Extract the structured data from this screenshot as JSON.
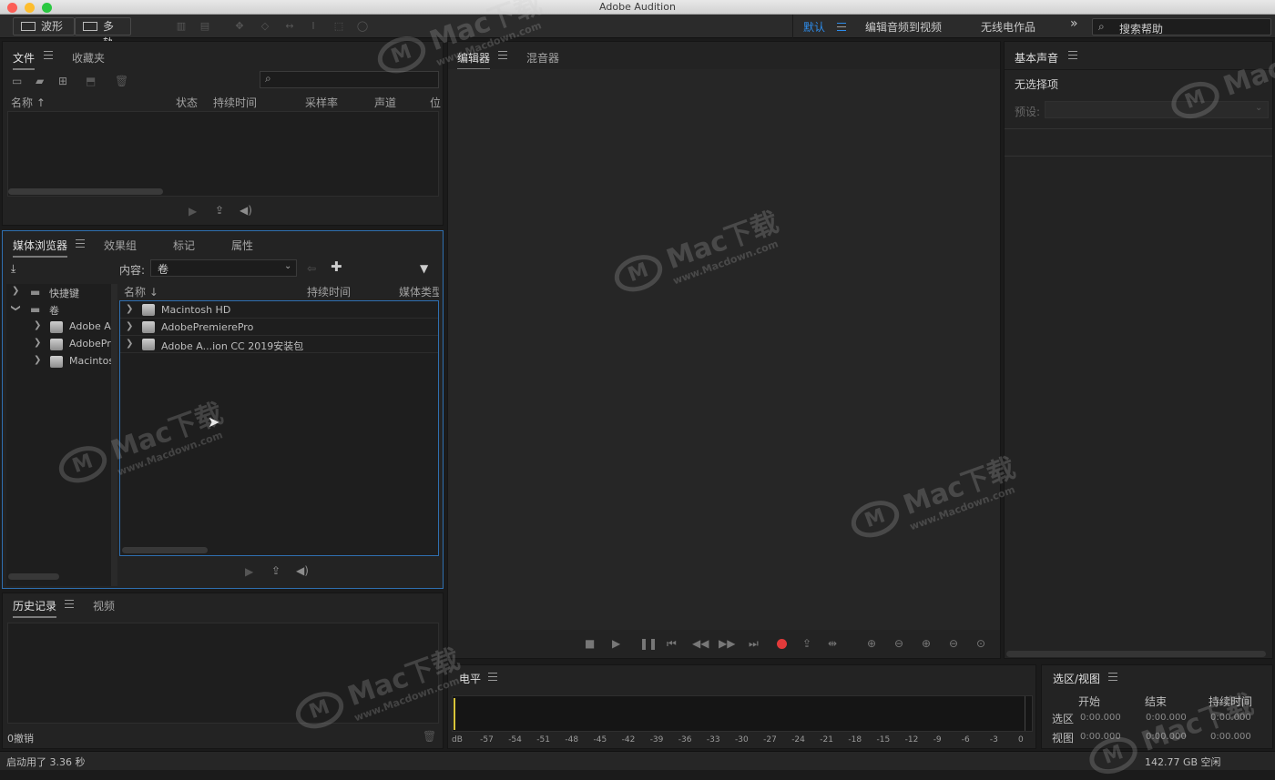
{
  "app": {
    "title": "Adobe Audition"
  },
  "toolbar": {
    "waveform": "波形",
    "multitrack": "多轨",
    "workspaces": [
      "默认",
      "编辑音频到视频",
      "无线电作品"
    ],
    "search_placeholder": "搜索帮助"
  },
  "files_panel": {
    "tabs": [
      "文件",
      "收藏夹"
    ],
    "columns": [
      "名称 ↑",
      "状态",
      "持续时间",
      "采样率",
      "声道",
      "位"
    ]
  },
  "media_panel": {
    "tabs": [
      "媒体浏览器",
      "效果组",
      "标记",
      "属性"
    ],
    "content_label": "内容:",
    "content_value": "卷",
    "tree": {
      "shortcuts": "快捷键",
      "volumes": "卷",
      "items": [
        "Adobe Au",
        "AdobePre",
        "Macintos"
      ]
    },
    "columns": [
      "名称 ↓",
      "持续时间",
      "媒体类型"
    ],
    "rows": [
      "Macintosh HD",
      "AdobePremierePro",
      "Adobe A...ion CC 2019安装包"
    ]
  },
  "history_panel": {
    "tabs": [
      "历史记录",
      "视频"
    ],
    "undo": "0撤销"
  },
  "status": {
    "startup": "启动用了 3.36 秒",
    "disk_free": "142.77 GB 空闲"
  },
  "editor_panel": {
    "tabs": [
      "编辑器",
      "混音器"
    ]
  },
  "essential_sound": {
    "title": "基本声音",
    "no_selection": "无选择项",
    "preset_label": "预设:"
  },
  "levels_panel": {
    "title": "电平",
    "scale": [
      "dB",
      "-57",
      "-54",
      "-51",
      "-48",
      "-45",
      "-42",
      "-39",
      "-36",
      "-33",
      "-30",
      "-27",
      "-24",
      "-21",
      "-18",
      "-15",
      "-12",
      "-9",
      "-6",
      "-3",
      "0"
    ]
  },
  "selection_panel": {
    "title": "选区/视图",
    "columns": [
      "开始",
      "结束",
      "持续时间"
    ],
    "rows": [
      {
        "label": "选区",
        "start": "0:00.000",
        "end": "0:00.000",
        "dur": "0:00.000"
      },
      {
        "label": "视图",
        "start": "0:00.000",
        "end": "0:00.000",
        "dur": "0:00.000"
      }
    ]
  },
  "watermark": {
    "brand": "Mac下载",
    "url": "www.Macdown.com"
  },
  "colors": {
    "accent": "#2d8ceb",
    "focus_border": "#2f6fb0",
    "record": "#e23a3a",
    "level_marker": "#d8c43a"
  }
}
